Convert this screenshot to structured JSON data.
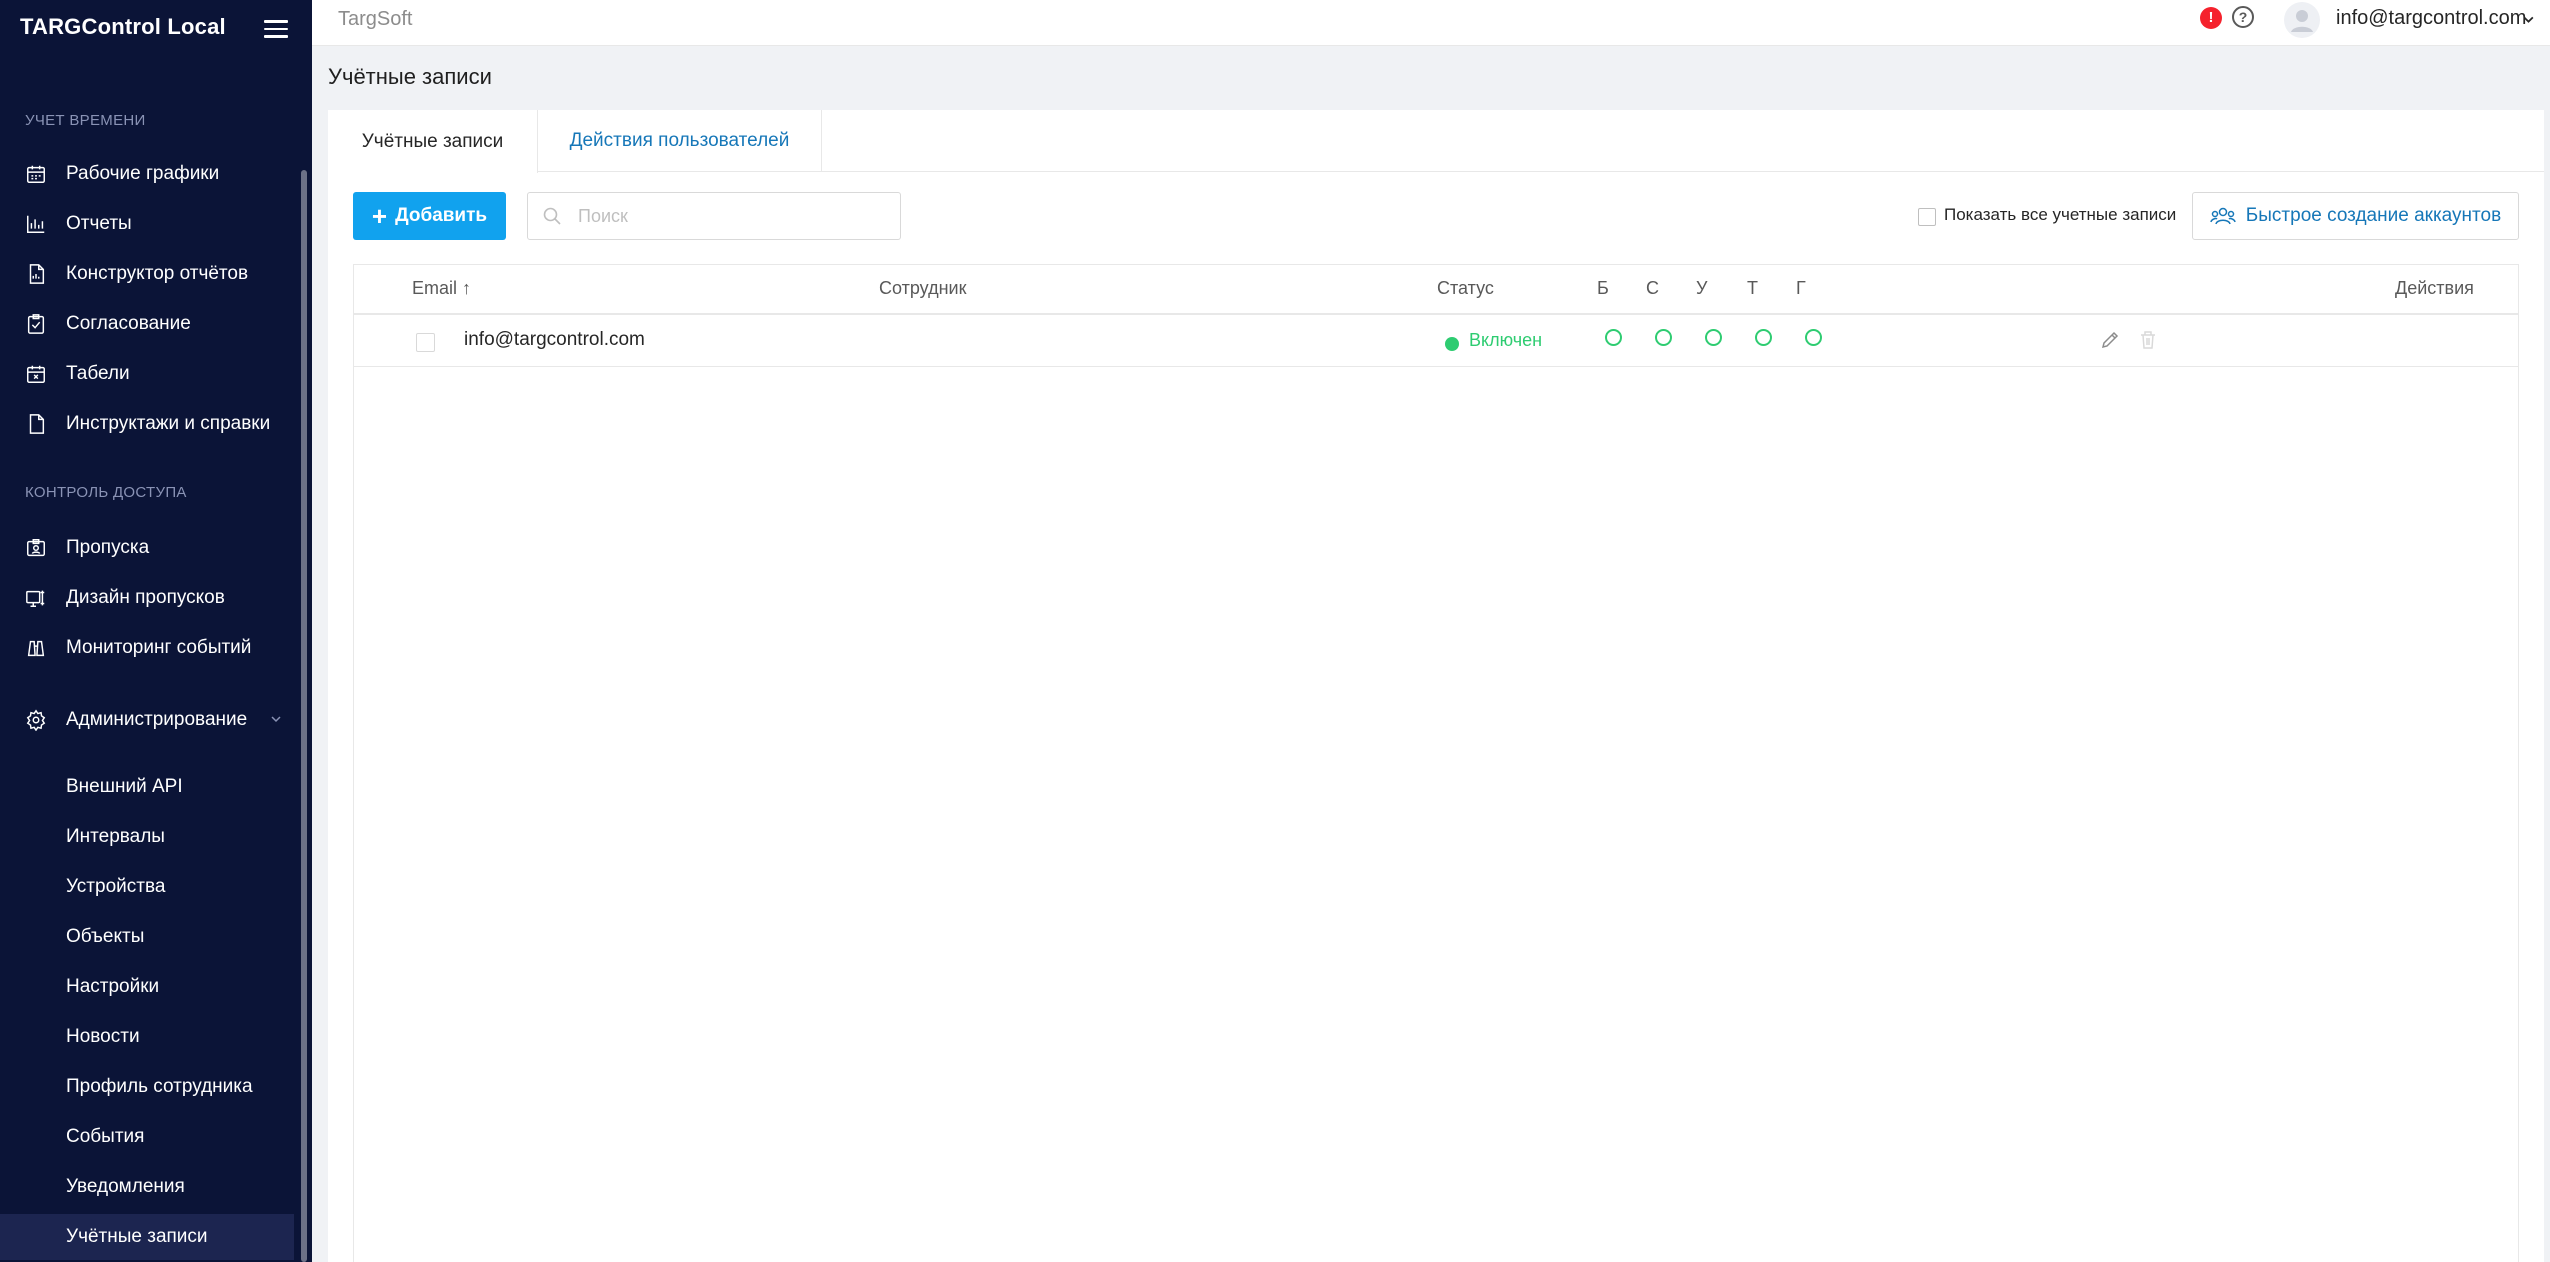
{
  "sidebar": {
    "brand": "TARGControl Local",
    "section_time": "УЧЕТ ВРЕМЕНИ",
    "section_access": "КОНТРОЛЬ ДОСТУПА",
    "time_items": [
      {
        "label": "Рабочие графики",
        "icon": "calendar-icon"
      },
      {
        "label": "Отчеты",
        "icon": "bar-chart-icon"
      },
      {
        "label": "Конструктор отчётов",
        "icon": "report-builder-icon"
      },
      {
        "label": "Согласование",
        "icon": "checked-clipboard-icon"
      },
      {
        "label": "Табели",
        "icon": "timesheet-icon"
      },
      {
        "label": "Инструктажи и справки",
        "icon": "document-icon"
      }
    ],
    "access_items": [
      {
        "label": "Пропуска",
        "icon": "badge-icon"
      },
      {
        "label": "Дизайн пропусков",
        "icon": "badge-design-icon"
      },
      {
        "label": "Мониторинг событий",
        "icon": "binoculars-icon"
      }
    ],
    "admin": {
      "label": "Администрирование",
      "icon": "gear-icon"
    },
    "admin_items": [
      "Внешний API",
      "Интервалы",
      "Устройства",
      "Объекты",
      "Настройки",
      "Новости",
      "Профиль сотрудника",
      "События",
      "Уведомления",
      "Учётные записи"
    ],
    "active_item": "Учётные записи"
  },
  "topbar": {
    "brand": "TargSoft",
    "alert_glyph": "!",
    "help_glyph": "?",
    "user_email": "info@targcontrol.com"
  },
  "page": {
    "title": "Учётные записи",
    "tabs": [
      {
        "label": "Учётные записи",
        "active": true
      },
      {
        "label": "Действия пользователей",
        "active": false
      }
    ],
    "toolbar": {
      "add_label": "Добавить",
      "add_glyph": "+",
      "search_placeholder": "Поиск",
      "show_all_label": "Показать все учетные записи",
      "quick_create_label": "Быстрое создание аккаунтов"
    },
    "table": {
      "headers": {
        "email": "Email ↑",
        "employee": "Сотрудник",
        "status": "Статус",
        "perm_b": "Б",
        "perm_s": "С",
        "perm_u": "У",
        "perm_t": "Т",
        "perm_g": "Г",
        "actions": "Действия"
      },
      "rows": [
        {
          "email": "info@targcontrol.com",
          "employee": "",
          "status": "Включен",
          "status_color": "#2ecc71"
        }
      ]
    }
  },
  "colors": {
    "sidebar_bg": "#0b1437",
    "accent": "#11a2ee",
    "link": "#1677b8",
    "success": "#2ecc71",
    "alert": "#f5222d"
  }
}
